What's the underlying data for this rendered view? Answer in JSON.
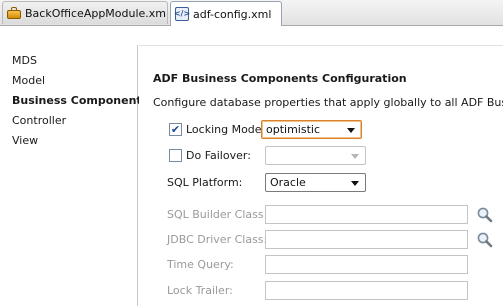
{
  "tabs": [
    {
      "label": "BackOfficeAppModule.xml",
      "icon": "app-module-icon"
    },
    {
      "label": "adf-config.xml",
      "icon": "config-file-icon"
    }
  ],
  "nav": {
    "items": [
      {
        "label": "MDS"
      },
      {
        "label": "Model"
      },
      {
        "label": "Business Components"
      },
      {
        "label": "Controller"
      },
      {
        "label": "View"
      }
    ]
  },
  "main": {
    "title": "ADF Business Components Configuration",
    "description": "Configure database properties that apply globally to all ADF Business Components",
    "locking_mode": {
      "label": "Locking Mode:",
      "checked": true,
      "value": "optimistic"
    },
    "do_failover": {
      "label": "Do Failover:",
      "checked": false,
      "value": ""
    },
    "sql_platform": {
      "label": "SQL Platform:",
      "value": "Oracle"
    },
    "sql_builder_class": {
      "label": "SQL Builder Class:",
      "value": ""
    },
    "jdbc_driver_class": {
      "label": "JDBC Driver Class:",
      "value": ""
    },
    "time_query": {
      "label": "Time Query:",
      "value": ""
    },
    "lock_trailer": {
      "label": "Lock Trailer:",
      "value": ""
    }
  },
  "colors": {
    "accent_focus": "#d9822b",
    "checkbox_check": "#1b4a9a",
    "disabled_text": "#9a9a9a"
  }
}
